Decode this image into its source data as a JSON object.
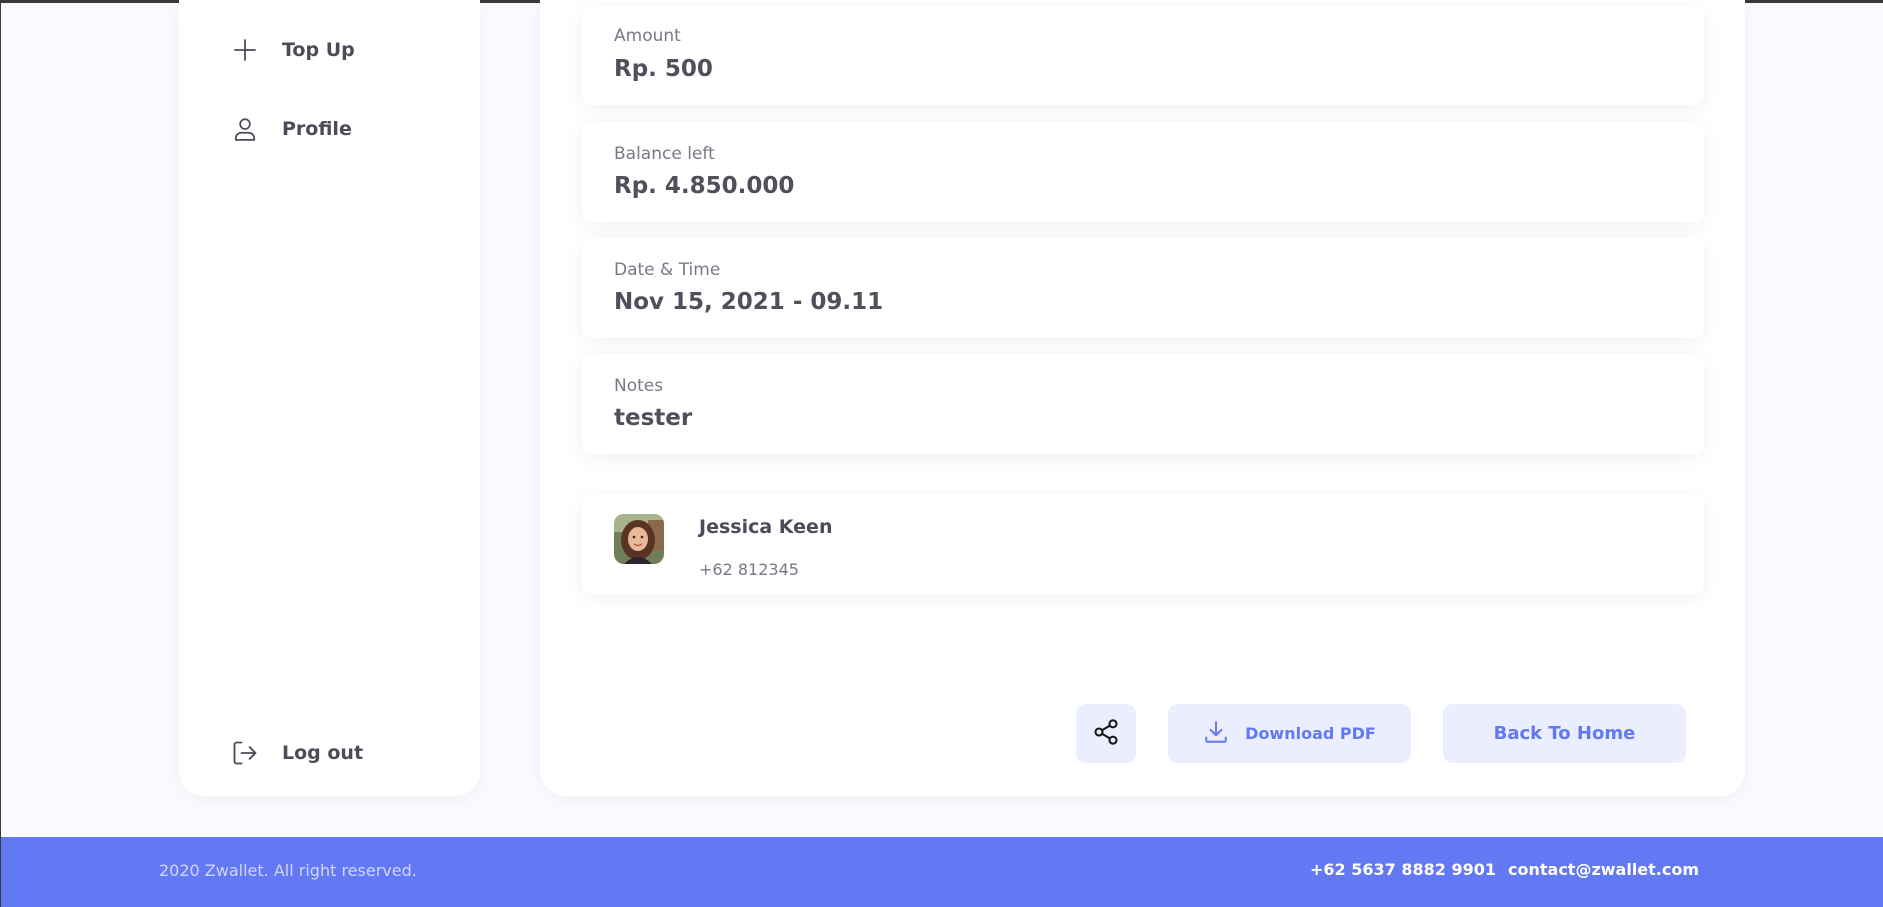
{
  "sidebar": {
    "items": [
      {
        "label": "Top Up",
        "icon": "plus-icon"
      },
      {
        "label": "Profile",
        "icon": "user-icon"
      }
    ],
    "logout": {
      "label": "Log out",
      "icon": "logout-icon"
    }
  },
  "details": {
    "amount": {
      "label": "Amount",
      "value": "Rp. 500"
    },
    "balance": {
      "label": "Balance left",
      "value": "Rp. 4.850.000"
    },
    "datetime": {
      "label": "Date & Time",
      "value": "Nov 15, 2021 - 09.11"
    },
    "notes": {
      "label": "Notes",
      "value": "tester"
    }
  },
  "receiver": {
    "name": "Jessica Keen",
    "phone": "+62 812345"
  },
  "actions": {
    "share_icon": "share-icon",
    "download_label": "Download PDF",
    "download_icon": "download-icon",
    "home_label": "Back To Home"
  },
  "footer": {
    "copyright": "2020 Zwallet. All right reserved.",
    "phone": "+62 5637 8882 9901",
    "email": "contact@zwallet.com"
  },
  "colors": {
    "accent": "#6379f4",
    "button_bg": "#eaeefe",
    "text_dark": "#4d4b57",
    "text_muted": "#7a7886"
  }
}
